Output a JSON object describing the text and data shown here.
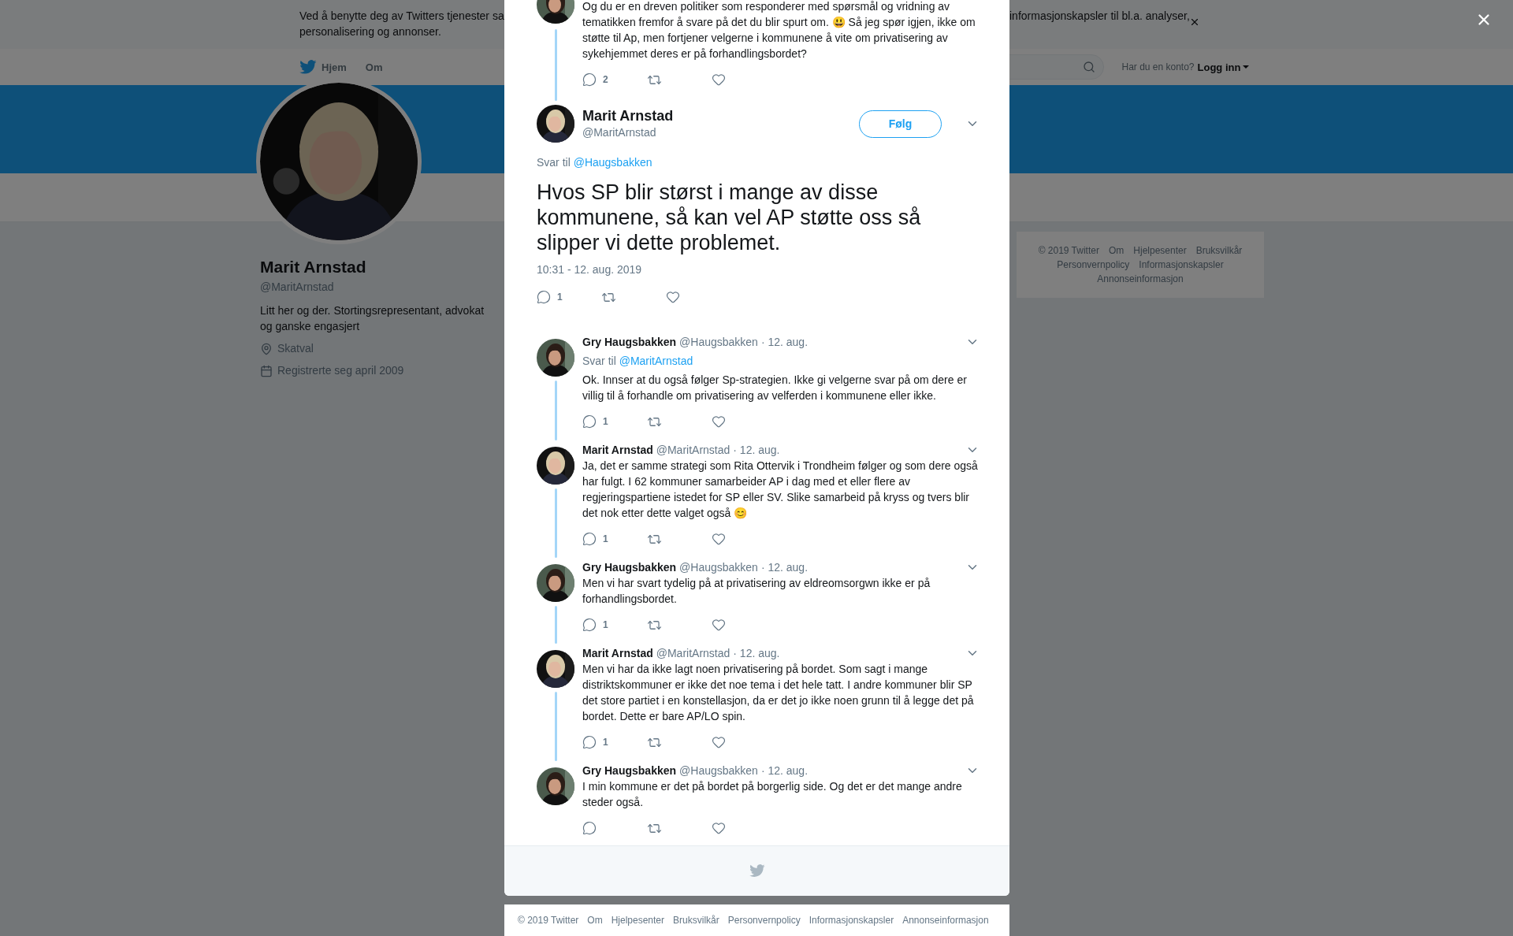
{
  "banner": {
    "line1_start": "Ved å benytte deg av Twitters tjenester sa",
    "line1_end": "informasjonskapsler til bl.a. analyser,",
    "line2": "personalisering og annonser."
  },
  "nav": {
    "items": [
      {
        "label": "Hjem",
        "kind": "logo"
      },
      {
        "label": "Om",
        "kind": "plain"
      }
    ],
    "account_prompt": "Har du en konto?",
    "login": "Logg inn"
  },
  "profile": {
    "name": "Marit Arnstad",
    "handle": "@MaritArnstad",
    "bio": "Litt her og der. Stortingsrepresentant, advokat og ganske engasjert",
    "location": "Skatval",
    "joined": "Registrerte seg april 2009"
  },
  "side_footer": [
    "© 2019 Twitter",
    "Om",
    "Hjelpesenter",
    "Bruksvilkår",
    "Personvernpolicy",
    "Informasjonskapsler",
    "Annonseinformasjon"
  ],
  "thread": [
    {
      "kind": "context",
      "text": "Og du er en dreven politiker som responderer med spørsmål og vridning av tematikken fremfor å svare på det du blir spurt om. 😃 Så jeg spør igjen, ikke om støtte til Ap, men fortjener velgerne i kommunene å vite om privatisering av sykehjemmet deres er på forhandlingsbordet?",
      "reply_count": "2"
    },
    {
      "kind": "focus",
      "name": "Marit Arnstad",
      "handle": "@MaritArnstad",
      "follow": "Følg",
      "reply_label": "Svar til",
      "reply_to": "@Haugsbakken",
      "text": "Hvos SP blir størst i mange av disse kommunene, så kan vel AP støtte oss så slipper vi dette problemet.",
      "time": "10:31 - 12. aug. 2019",
      "reply_count": "1"
    },
    {
      "kind": "reply",
      "name": "Gry Haugsbakken",
      "handle": "@Haugsbakken",
      "date": "· 12. aug.",
      "reply_label": "Svar til",
      "reply_to": "@MaritArnstad",
      "text": "Ok. Innser at du også følger Sp-strategien. Ikke gi velgerne svar på om dere er villig til å forhandle om privatisering av velferden i kommunene eller ikke.",
      "reply_count": "1"
    },
    {
      "kind": "reply",
      "name": "Marit Arnstad",
      "handle": "@MaritArnstad",
      "date": "· 12. aug.",
      "text": "Ja, det er samme strategi som Rita Ottervik i Trondheim følger og som dere også har fulgt. I 62 kommuner samarbeider AP i dag med et eller flere av regjeringspartiene istedet for SP eller SV. Slike samarbeid på kryss og tvers blir det nok etter dette valget også 😊",
      "reply_count": "1"
    },
    {
      "kind": "reply",
      "name": "Gry Haugsbakken",
      "handle": "@Haugsbakken",
      "date": "· 12. aug.",
      "text": "Men vi har svart tydelig på at privatisering av eldreomsorgwn ikke er på forhandlingsbordet.",
      "reply_count": "1"
    },
    {
      "kind": "reply",
      "name": "Marit Arnstad",
      "handle": "@MaritArnstad",
      "date": "· 12. aug.",
      "text": "Men vi har da ikke lagt noen privatisering på bordet. Som sagt i mange distriktskommuner er ikke det noe tema i det hele tatt. I andre kommuner blir SP det store partiet i en konstellasjon,  da er det jo ikke noen grunn til å legge det på bordet. Dette er bare AP/LO spin.",
      "reply_count": "1"
    },
    {
      "kind": "reply",
      "name": "Gry Haugsbakken",
      "handle": "@Haugsbakken",
      "date": "· 12. aug.",
      "text": "I min kommune er det på bordet på borgerlig side. Og det er det mange andre steder også."
    }
  ],
  "modal_footer": [
    "© 2019 Twitter",
    "Om",
    "Hjelpesenter",
    "Bruksvilkår",
    "Personvernpolicy",
    "Informasjonskapsler",
    "Annonseinformasjon"
  ]
}
